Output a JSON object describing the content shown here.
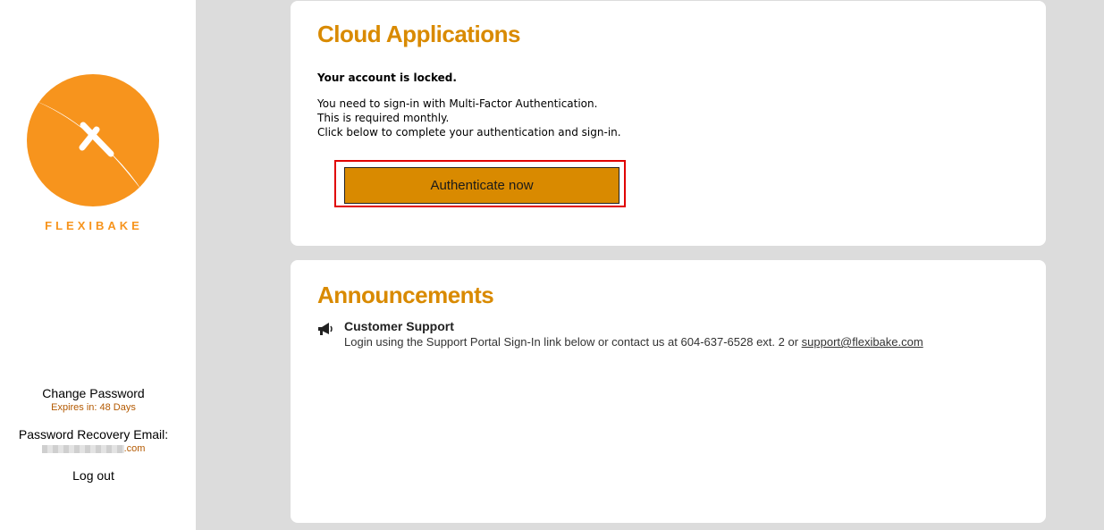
{
  "sidebar": {
    "brand": "FLEXIBAKE",
    "change_password": "Change Password",
    "expires": "Expires in: 48 Days",
    "recovery_label": "Password Recovery Email:",
    "recovery_email_suffix": ".com",
    "logout": "Log out"
  },
  "cloud": {
    "title": "Cloud Applications",
    "locked": "Your account is locked.",
    "line1": "You need to sign-in with Multi-Factor Authentication.",
    "line2": "This is required monthly.",
    "line3": "Click below to complete your authentication and sign-in.",
    "button": "Authenticate now"
  },
  "announcements": {
    "title": "Announcements",
    "item_title": "Customer Support",
    "item_text": "Login using the Support Portal Sign-In link below or contact us at 604-637-6528 ext. 2 or ",
    "item_link": "support@flexibake.com",
    "icon": "megaphone-icon"
  },
  "colors": {
    "accent": "#d98a00",
    "logo_orange": "#f7941d",
    "highlight": "#e00000"
  }
}
